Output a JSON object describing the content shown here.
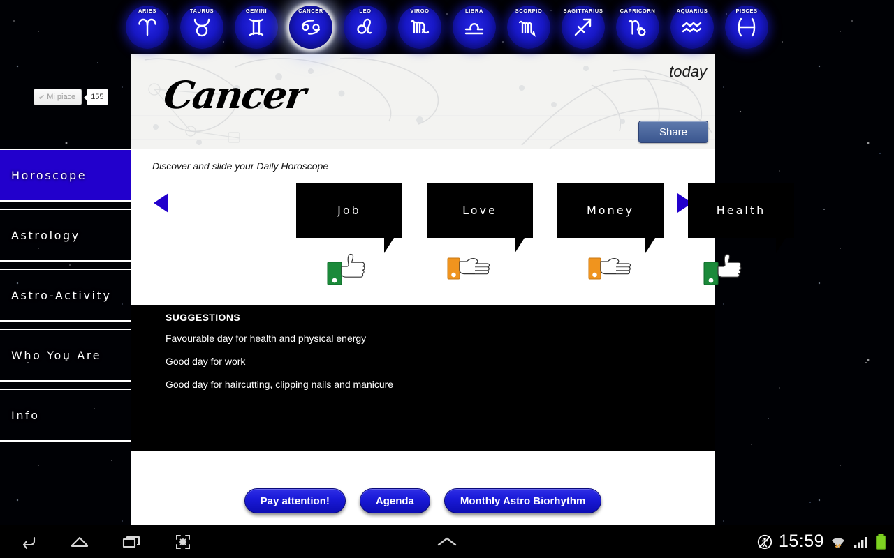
{
  "zodiac": {
    "signs": [
      {
        "name": "ARIES",
        "glyph": "aries-icon",
        "selected": false
      },
      {
        "name": "TAURUS",
        "glyph": "taurus-icon",
        "selected": false
      },
      {
        "name": "GEMINI",
        "glyph": "gemini-icon",
        "selected": false
      },
      {
        "name": "CANCER",
        "glyph": "cancer-icon",
        "selected": true
      },
      {
        "name": "LEO",
        "glyph": "leo-icon",
        "selected": false
      },
      {
        "name": "VIRGO",
        "glyph": "virgo-icon",
        "selected": false
      },
      {
        "name": "LIBRA",
        "glyph": "libra-icon",
        "selected": false
      },
      {
        "name": "SCORPIO",
        "glyph": "scorpio-icon",
        "selected": false
      },
      {
        "name": "SAGITTARIUS",
        "glyph": "sagittarius-icon",
        "selected": false
      },
      {
        "name": "CAPRICORN",
        "glyph": "capricorn-icon",
        "selected": false
      },
      {
        "name": "AQUARIUS",
        "glyph": "aquarius-icon",
        "selected": false
      },
      {
        "name": "PISCES",
        "glyph": "pisces-icon",
        "selected": false
      }
    ]
  },
  "facebook_like": {
    "label": "Mi piace",
    "check_glyph": "✔",
    "count": "155"
  },
  "sidebar": {
    "items": [
      {
        "label": "Horoscope",
        "active": true
      },
      {
        "label": "Astrology",
        "active": false
      },
      {
        "label": "Astro-Activity",
        "active": false
      },
      {
        "label": "Who You Are",
        "active": false
      },
      {
        "label": "Info",
        "active": false
      }
    ],
    "active_color": "#2200cc"
  },
  "banner": {
    "sign_title": "Cancer",
    "period": "today",
    "share_label": "Share",
    "share_color": "#4a6699"
  },
  "slider": {
    "instruction": "Discover and slide your Daily Horoscope",
    "prev_label": "previous",
    "next_label": "next",
    "arrow_color": "#2200cc",
    "cards": [
      {
        "label": "Job",
        "rating": "up",
        "sleeve_color": "#1b8a3a"
      },
      {
        "label": "Love",
        "rating": "neutral",
        "sleeve_color": "#f0941e"
      },
      {
        "label": "Money",
        "rating": "neutral",
        "sleeve_color": "#f0941e"
      },
      {
        "label": "Health",
        "rating": "up",
        "sleeve_color": "#1b8a3a"
      }
    ]
  },
  "suggestions": {
    "heading": "SUGGESTIONS",
    "items": [
      "Favourable day for health and physical energy",
      "Good day for work",
      "Good day for haircutting, clipping nails and manicure"
    ]
  },
  "actions": {
    "buttons": [
      {
        "label": "Pay attention!"
      },
      {
        "label": "Agenda"
      },
      {
        "label": "Monthly Astro Biorhythm"
      }
    ],
    "button_color": "#1a1ad8"
  },
  "navbar": {
    "back": "back-icon",
    "home": "home-icon",
    "recents": "recents-icon",
    "screenshot": "screenshot-icon",
    "expand": "chevron-up-icon"
  },
  "status": {
    "mute_icon": "mute-icon",
    "time": "15:59",
    "wifi_icon": "wifi-icon",
    "signal_icon": "signal-icon",
    "battery_icon": "battery-icon",
    "battery_color": "#7ed321"
  }
}
